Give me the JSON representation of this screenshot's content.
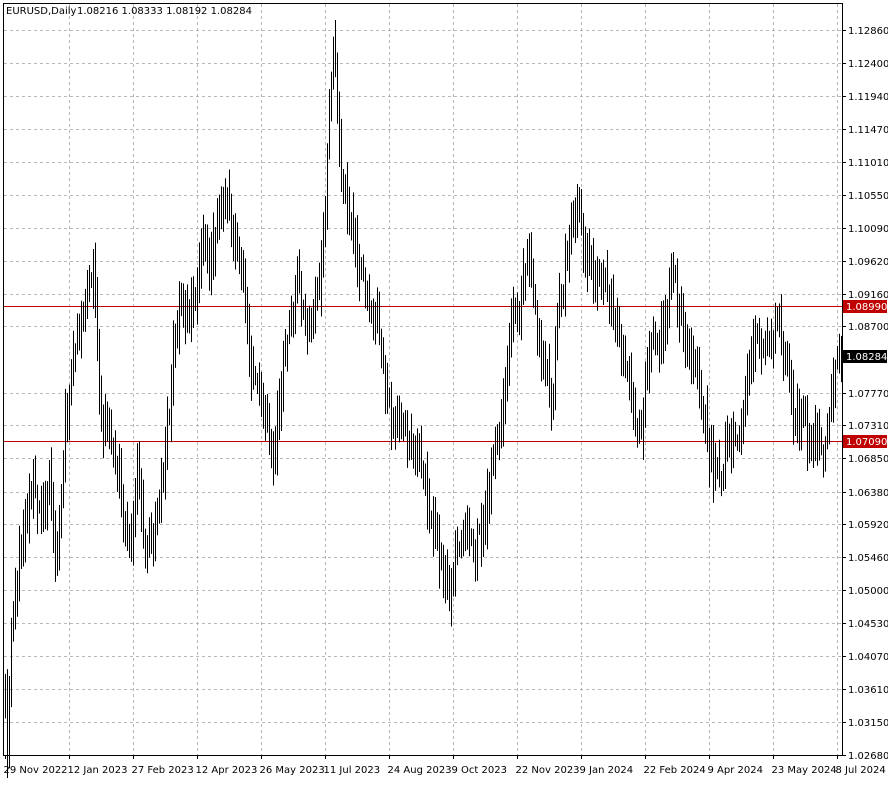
{
  "header": {
    "symbol_label": "EURUSD,Daily",
    "ohlc_text": "1.08216 1.08333 1.08192 1.08284"
  },
  "chart_data": {
    "type": "bar",
    "title": "EURUSD,Daily",
    "bar_style": "ohlc",
    "grid": true,
    "grid_style": "dashed",
    "ylim": [
      1.0268,
      1.1323
    ],
    "y_ticks": [
      1.0268,
      1.0315,
      1.0361,
      1.0407,
      1.0453,
      1.05,
      1.0546,
      1.0592,
      1.0638,
      1.0685,
      1.0731,
      1.0777,
      1.087,
      1.0916,
      1.0962,
      1.1009,
      1.1055,
      1.1101,
      1.1147,
      1.1194,
      1.124,
      1.1286
    ],
    "y_tick_labels": [
      "1.02680",
      "1.03150",
      "1.03610",
      "1.04070",
      "1.04530",
      "1.05000",
      "1.05460",
      "1.05920",
      "1.06380",
      "1.06850",
      "1.07310",
      "1.07770",
      "1.08700",
      "1.09160",
      "1.09620",
      "1.10090",
      "1.10550",
      "1.11010",
      "1.11470",
      "1.11940",
      "1.12400",
      "1.12860"
    ],
    "x_tick_labels": [
      "29 Nov 2022",
      "12 Jan 2023",
      "27 Feb 2023",
      "12 Apr 2023",
      "26 May 2023",
      "11 Jul 2023",
      "24 Aug 2023",
      "9 Oct 2023",
      "22 Nov 2023",
      "9 Jan 2024",
      "22 Feb 2024",
      "9 Apr 2024",
      "23 May 2024",
      "8 Jul 2024"
    ],
    "x_tick_bar_index": [
      0,
      32,
      64,
      96,
      128,
      160,
      192,
      224,
      256,
      288,
      320,
      352,
      384,
      416
    ],
    "bar_count": 419,
    "current_price": {
      "label": "1.08284",
      "value": 1.08284
    },
    "levels": [
      {
        "label": "1.08990",
        "value": 1.0899,
        "color": "#c00000"
      },
      {
        "label": "1.07090",
        "value": 1.0709,
        "color": "#c00000"
      }
    ],
    "anchors": [
      [
        0,
        1.035
      ],
      [
        1,
        1.028
      ],
      [
        3,
        1.043
      ],
      [
        6,
        1.052
      ],
      [
        10,
        1.058
      ],
      [
        14,
        1.067
      ],
      [
        18,
        1.058
      ],
      [
        22,
        1.066
      ],
      [
        26,
        1.052
      ],
      [
        30,
        1.073
      ],
      [
        34,
        1.083
      ],
      [
        40,
        1.089
      ],
      [
        44,
        1.096
      ],
      [
        48,
        1.074
      ],
      [
        52,
        1.072
      ],
      [
        58,
        1.064
      ],
      [
        62,
        1.056
      ],
      [
        66,
        1.068
      ],
      [
        70,
        1.054
      ],
      [
        74,
        1.058
      ],
      [
        78,
        1.064
      ],
      [
        82,
        1.076
      ],
      [
        86,
        1.089
      ],
      [
        90,
        1.088
      ],
      [
        94,
        1.089
      ],
      [
        98,
        1.098
      ],
      [
        102,
        1.096
      ],
      [
        106,
        1.102
      ],
      [
        110,
        1.105
      ],
      [
        114,
        1.101
      ],
      [
        118,
        1.093
      ],
      [
        122,
        1.084
      ],
      [
        126,
        1.078
      ],
      [
        130,
        1.073
      ],
      [
        134,
        1.068
      ],
      [
        138,
        1.079
      ],
      [
        142,
        1.088
      ],
      [
        146,
        1.094
      ],
      [
        150,
        1.086
      ],
      [
        154,
        1.089
      ],
      [
        158,
        1.096
      ],
      [
        160,
        1.106
      ],
      [
        162,
        1.121
      ],
      [
        164,
        1.126
      ],
      [
        166,
        1.118
      ],
      [
        168,
        1.108
      ],
      [
        170,
        1.106
      ],
      [
        174,
        1.099
      ],
      [
        178,
        1.094
      ],
      [
        182,
        1.089
      ],
      [
        186,
        1.088
      ],
      [
        190,
        1.079
      ],
      [
        194,
        1.074
      ],
      [
        198,
        1.073
      ],
      [
        202,
        1.071
      ],
      [
        206,
        1.069
      ],
      [
        210,
        1.064
      ],
      [
        214,
        1.059
      ],
      [
        218,
        1.054
      ],
      [
        222,
        1.049
      ],
      [
        226,
        1.055
      ],
      [
        230,
        1.058
      ],
      [
        234,
        1.056
      ],
      [
        238,
        1.058
      ],
      [
        242,
        1.063
      ],
      [
        246,
        1.071
      ],
      [
        250,
        1.077
      ],
      [
        252,
        1.086
      ],
      [
        256,
        1.089
      ],
      [
        260,
        1.094
      ],
      [
        262,
        1.099
      ],
      [
        266,
        1.087
      ],
      [
        270,
        1.081
      ],
      [
        274,
        1.077
      ],
      [
        276,
        1.089
      ],
      [
        280,
        1.095
      ],
      [
        284,
        1.103
      ],
      [
        286,
        1.104
      ],
      [
        290,
        1.097
      ],
      [
        294,
        1.094
      ],
      [
        298,
        1.093
      ],
      [
        302,
        1.091
      ],
      [
        306,
        1.086
      ],
      [
        310,
        1.083
      ],
      [
        314,
        1.077
      ],
      [
        318,
        1.071
      ],
      [
        322,
        1.083
      ],
      [
        326,
        1.084
      ],
      [
        330,
        1.087
      ],
      [
        334,
        1.096
      ],
      [
        338,
        1.087
      ],
      [
        342,
        1.083
      ],
      [
        346,
        1.079
      ],
      [
        350,
        1.074
      ],
      [
        354,
        1.066
      ],
      [
        358,
        1.067
      ],
      [
        362,
        1.072
      ],
      [
        366,
        1.072
      ],
      [
        370,
        1.078
      ],
      [
        374,
        1.084
      ],
      [
        378,
        1.086
      ],
      [
        382,
        1.084
      ],
      [
        386,
        1.088
      ],
      [
        390,
        1.083
      ],
      [
        394,
        1.076
      ],
      [
        398,
        1.074
      ],
      [
        402,
        1.071
      ],
      [
        406,
        1.07
      ],
      [
        410,
        1.071
      ],
      [
        414,
        1.079
      ],
      [
        416,
        1.083
      ],
      [
        418,
        1.0828
      ]
    ]
  }
}
